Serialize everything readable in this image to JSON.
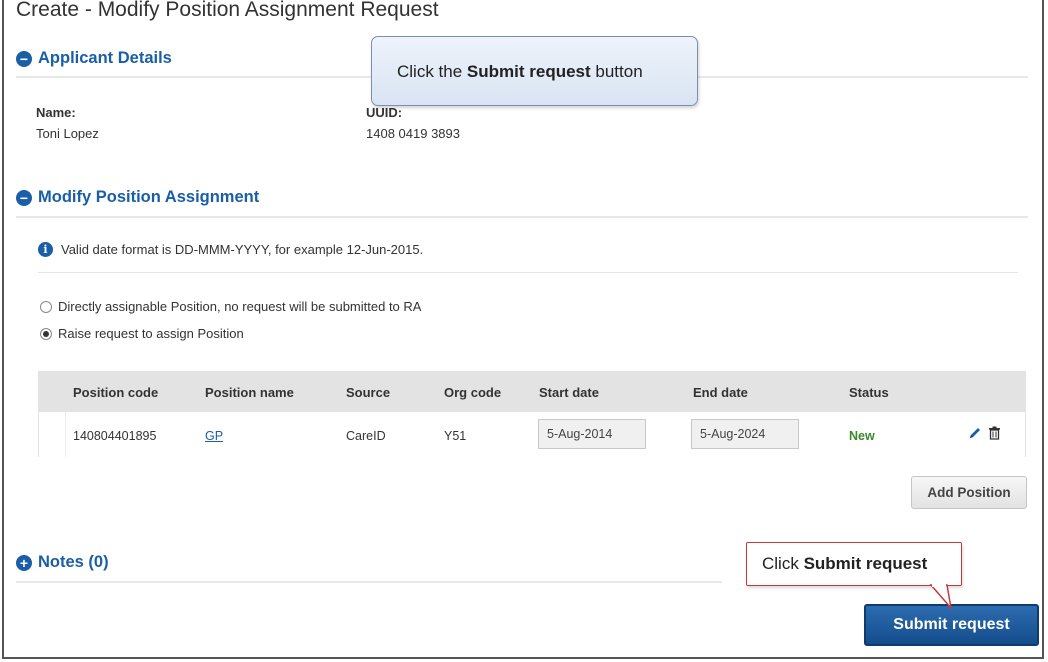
{
  "page": {
    "title": "Create - Modify Position Assignment Request"
  },
  "applicant": {
    "heading": "Applicant Details",
    "name_label": "Name:",
    "name_value": "Toni Lopez",
    "uuid_label": "UUID:",
    "uuid_value": "1408 0419 3893"
  },
  "assignment": {
    "heading": "Modify Position Assignment",
    "info_text": "Valid date format is DD-MMM-YYYY, for example 12-Jun-2015.",
    "options": [
      {
        "label": "Directly assignable Position, no request will be submitted to RA",
        "selected": false
      },
      {
        "label": "Raise request to assign Position",
        "selected": true
      }
    ],
    "table": {
      "columns": [
        "Position code",
        "Position name",
        "Source",
        "Org code",
        "Start date",
        "End date",
        "Status"
      ],
      "rows": [
        {
          "position_code": "140804401895",
          "position_name": "GP",
          "source": "CareID",
          "org_code": "Y51",
          "start_date": "5-Aug-2014",
          "end_date": "5-Aug-2024",
          "status": "New"
        }
      ]
    },
    "add_button": "Add Position"
  },
  "notes": {
    "heading": "Notes (0)"
  },
  "actions": {
    "submit_label": "Submit request"
  },
  "callouts": {
    "top_prefix": "Click the ",
    "top_bold": "Submit request",
    "top_suffix": " button",
    "bottom_prefix": "Click ",
    "bottom_bold": "Submit request"
  },
  "colors": {
    "accent": "#1a5ea8",
    "status_new": "#3a8a2a",
    "callout_border": "#c8383b"
  }
}
